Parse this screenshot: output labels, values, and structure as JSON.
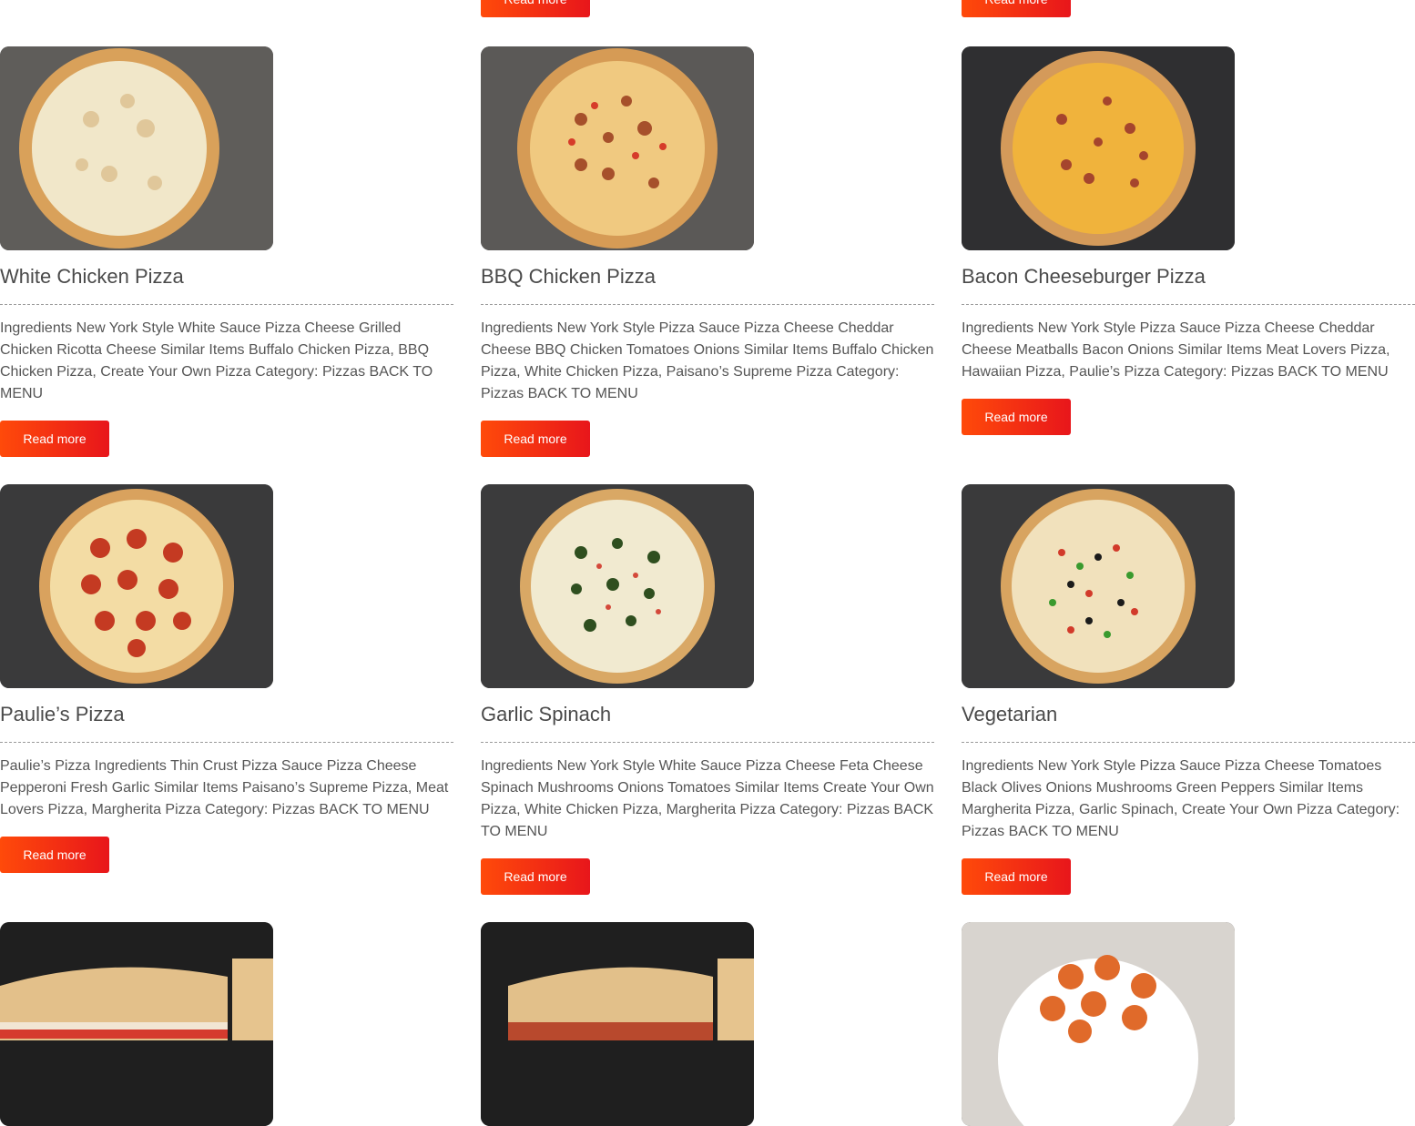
{
  "read_more_label": "Read more",
  "top_row": {
    "buttons": [
      "Read more",
      "Read more"
    ]
  },
  "rows": [
    [
      {
        "title": "White Chicken Pizza",
        "desc": "Ingredients New York Style White Sauce Pizza Cheese Grilled Chicken Ricotta Cheese Similar Items Buffalo Chicken Pizza, BBQ Chicken Pizza, Create Your Own Pizza Category: Pizzas BACK TO MENU",
        "button": "Read more",
        "image_icon": "white-chicken-pizza"
      },
      {
        "title": "BBQ Chicken Pizza",
        "desc": "Ingredients New York Style Pizza Sauce Pizza Cheese Cheddar Cheese BBQ Chicken Tomatoes Onions Similar Items  Buffalo Chicken Pizza, White Chicken Pizza, Paisano’s Supreme Pizza Category: Pizzas BACK TO MENU",
        "button": "Read more",
        "image_icon": "bbq-chicken-pizza"
      },
      {
        "title": "Bacon Cheeseburger Pizza",
        "desc": "Ingredients New York Style Pizza Sauce Pizza Cheese Cheddar Cheese Meatballs Bacon Onions Similar Items  Meat Lovers Pizza, Hawaiian Pizza, Paulie’s Pizza Category: Pizzas BACK TO MENU",
        "button": "Read more",
        "image_icon": "bacon-cheeseburger-pizza"
      }
    ],
    [
      {
        "title": "Paulie’s Pizza",
        "desc": "Paulie’s Pizza Ingredients Thin Crust Pizza Sauce Pizza Cheese Pepperoni Fresh Garlic Similar Items Paisano’s Supreme Pizza, Meat Lovers Pizza,  Margherita Pizza Category: Pizzas BACK TO MENU",
        "button": "Read more",
        "image_icon": "pepperoni-pizza"
      },
      {
        "title": "Garlic Spinach",
        "desc": "Ingredients New York Style White Sauce Pizza Cheese Feta Cheese Spinach Mushrooms Onions Tomatoes Similar Items  Create Your Own Pizza, White Chicken Pizza, Margherita Pizza Category: Pizzas BACK TO MENU",
        "button": "Read more",
        "image_icon": "garlic-spinach-pizza"
      },
      {
        "title": "Vegetarian",
        "desc": "Ingredients New York Style Pizza Sauce Pizza Cheese Tomatoes Black Olives Onions Mushrooms Green Peppers Similar Items Margherita Pizza, Garlic Spinach, Create Your Own Pizza Category: Pizzas BACK TO MENU",
        "button": "Read more",
        "image_icon": "vegetarian-pizza"
      }
    ]
  ],
  "bottom_row": {
    "image_icons": [
      "chicken-sandwich",
      "meatball-sandwich",
      "buffalo-wings-plate"
    ]
  },
  "colors": {
    "button_start": "#ff4a0a",
    "button_end": "#e8161b",
    "title": "#4a4a4a",
    "text": "#555555"
  }
}
